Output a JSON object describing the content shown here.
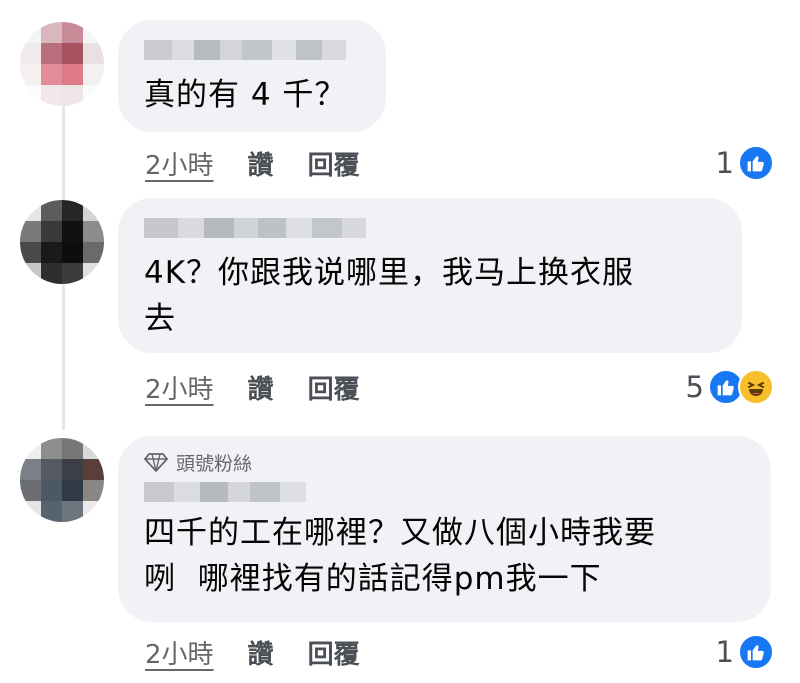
{
  "comments": [
    {
      "text": "真的有 4 千？",
      "time": "2小時",
      "like_label": "讚",
      "reply_label": "回覆",
      "reaction_count": "1",
      "reactions": [
        "like"
      ]
    },
    {
      "text": "4K？你跟我说哪里，我马上换衣服\n去",
      "time": "2小時",
      "like_label": "讚",
      "reply_label": "回覆",
      "reaction_count": "5",
      "reactions": [
        "like",
        "haha"
      ]
    },
    {
      "badge": "頭號粉絲",
      "text": "四千的工在哪裡？又做八個小時我要\n咧  哪裡找有的話記得pm我一下",
      "time": "2小時",
      "like_label": "讚",
      "reply_label": "回覆",
      "reaction_count": "1",
      "reactions": [
        "like"
      ]
    }
  ],
  "colors": {
    "bubble": "#f0f2f5",
    "like_blue": "#1877f2",
    "haha_yellow": "#f7c02b",
    "meta_gray": "#65676b"
  },
  "icons": [
    "like-icon",
    "haha-icon",
    "diamond-icon"
  ]
}
